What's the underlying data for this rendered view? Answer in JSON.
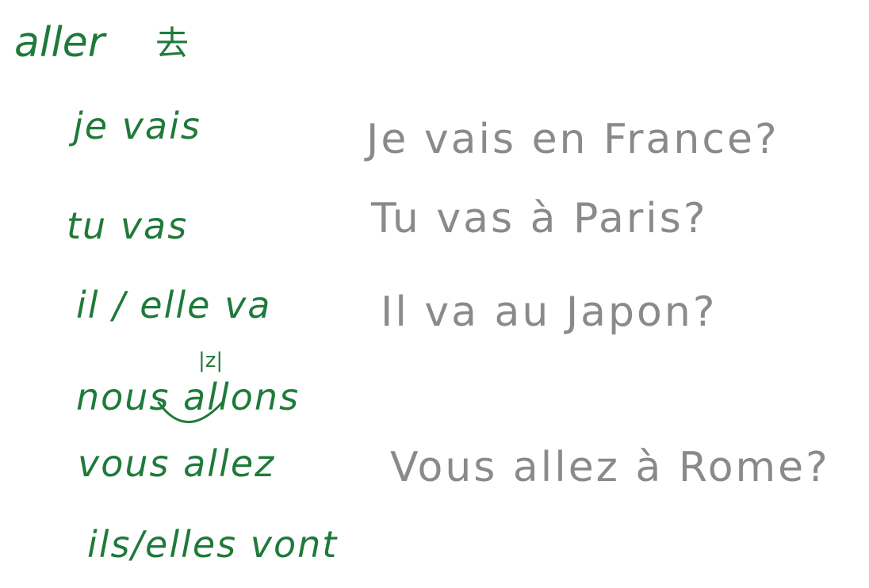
{
  "verb": {
    "infinitive": "aller",
    "hanzi": "去"
  },
  "conjugations": [
    "je vais",
    "tu vas",
    "il / elle va",
    "nous allons",
    "vous allez",
    "ils/elles vont"
  ],
  "liaison_note": "|z|",
  "examples": [
    "Je vais en France?",
    "Tu vas à Paris?",
    "Il va au Japon?",
    "Vous allez à Rome?"
  ],
  "colors": {
    "conjugation_ink": "#1f7a3a",
    "example_ink": "#8a8a8a"
  }
}
